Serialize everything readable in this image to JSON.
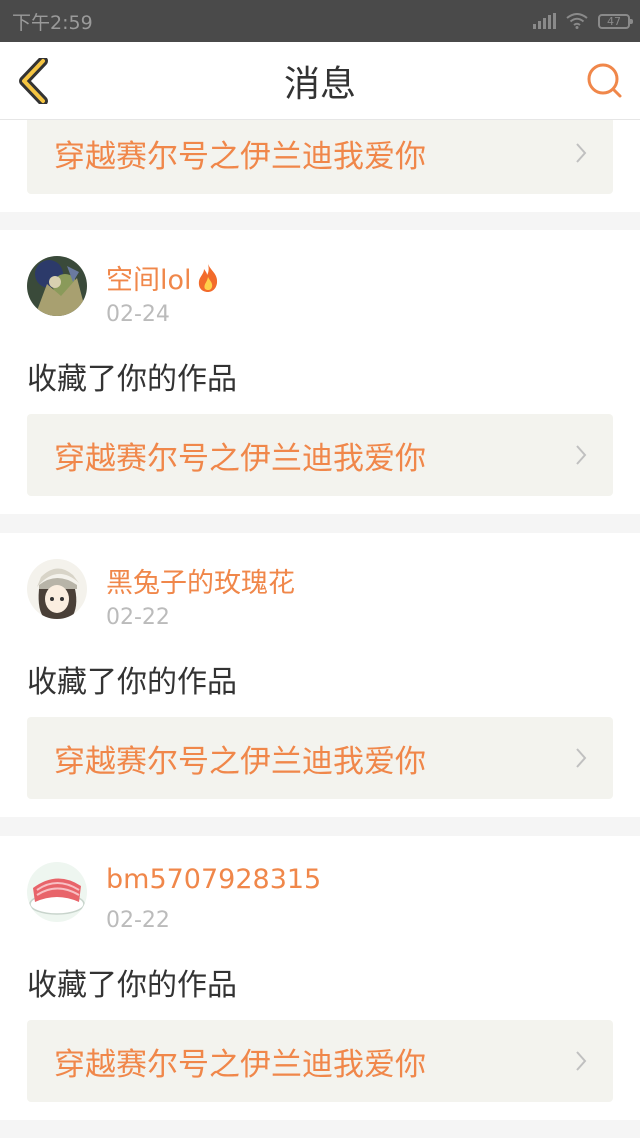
{
  "status_bar": {
    "time": "下午2:59",
    "battery": "47"
  },
  "nav": {
    "title": "消息"
  },
  "top_card": {
    "work_title": "穿越赛尔号之伊兰迪我爱你"
  },
  "messages": [
    {
      "user": "空间lol",
      "has_fire_badge": true,
      "date": "02-24",
      "action": "收藏了你的作品",
      "work_title": "穿越赛尔号之伊兰迪我爱你"
    },
    {
      "user": "黑兔子的玫瑰花",
      "has_fire_badge": false,
      "date": "02-22",
      "action": "收藏了你的作品",
      "work_title": "穿越赛尔号之伊兰迪我爱你"
    },
    {
      "user": "bm5707928315",
      "has_fire_badge": false,
      "date": "02-22",
      "action": "收藏了你的作品",
      "work_title": "穿越赛尔号之伊兰迪我爱你"
    }
  ],
  "colors": {
    "accent": "#f0874a",
    "status_bar": "#4a4a4a",
    "link_bg": "#f3f3ee",
    "page_bg": "#f5f5f5"
  }
}
